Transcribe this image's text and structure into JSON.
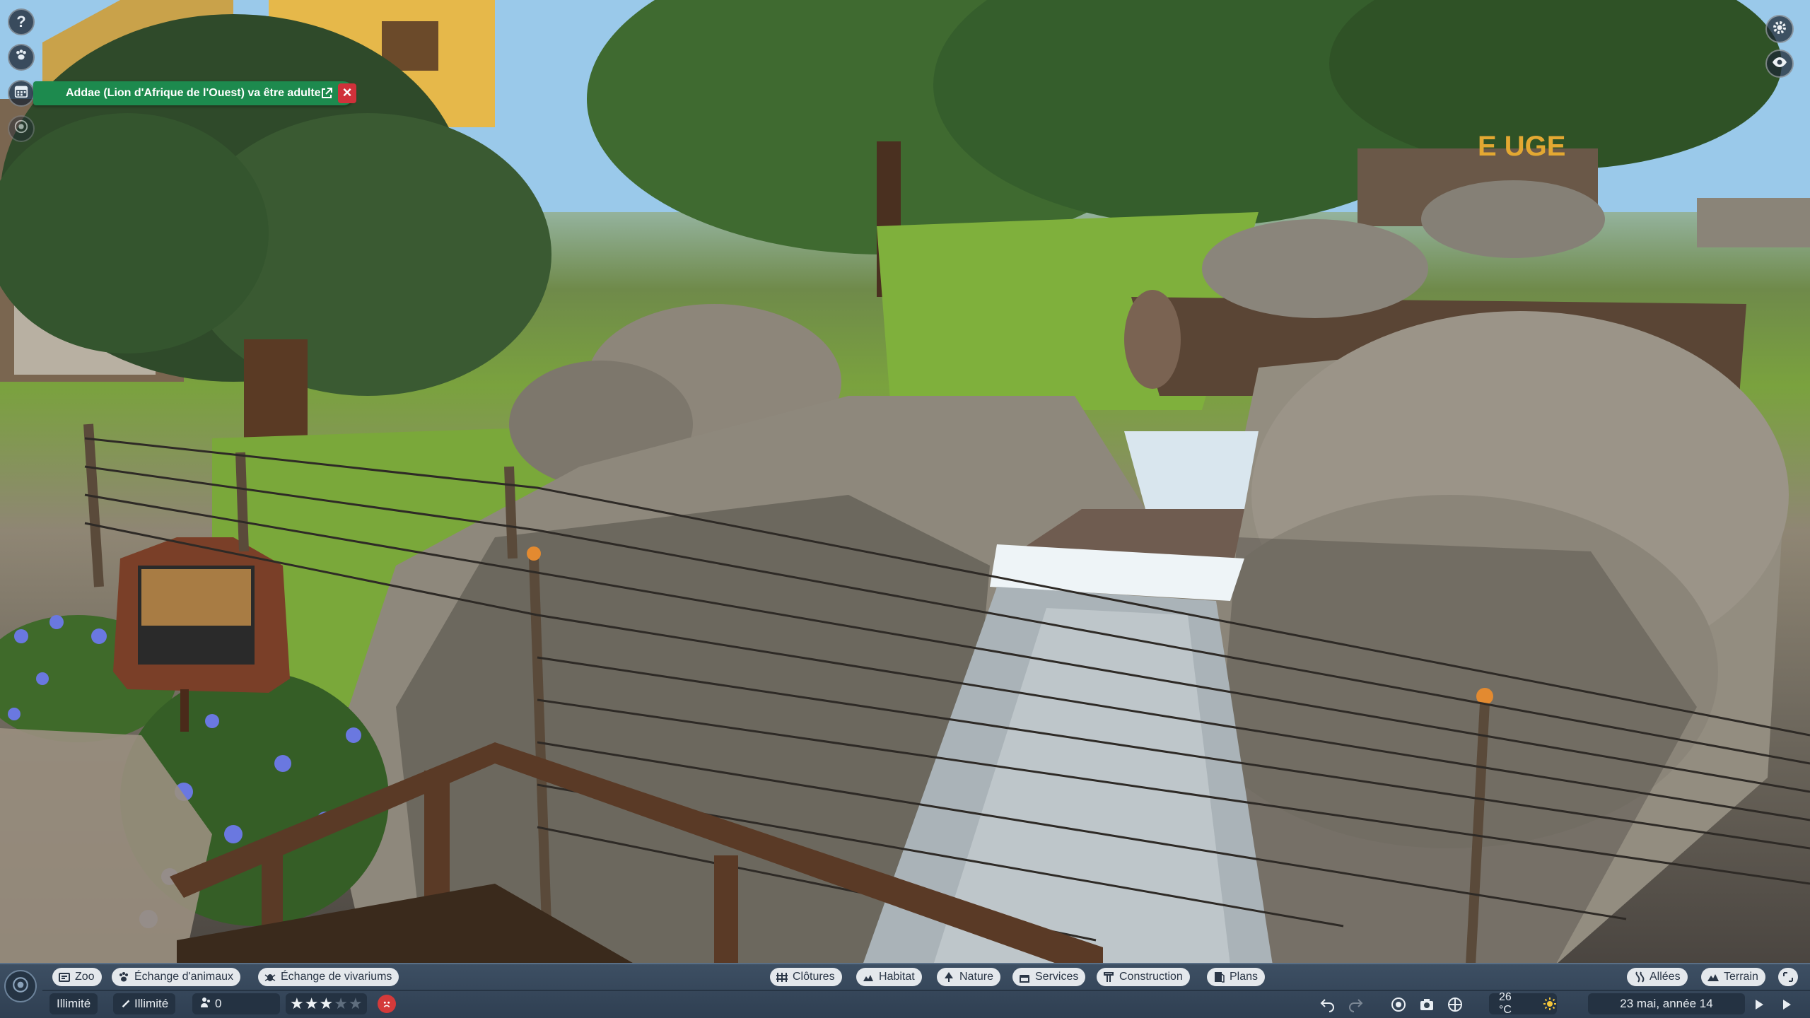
{
  "notification": {
    "text": "Addae (Lion d'Afrique de l'Ouest) va être adulte",
    "accent": "#1d8a4e",
    "close_color": "#d0313a"
  },
  "side_buttons": [
    {
      "name": "help-button",
      "icon": "help-icon",
      "glyph": "?"
    },
    {
      "name": "animal-button",
      "icon": "paw-icon"
    },
    {
      "name": "calendar-button",
      "icon": "calendar-icon"
    },
    {
      "name": "objectives-button",
      "icon": "target-icon"
    }
  ],
  "right_buttons": [
    {
      "name": "settings-button",
      "icon": "gear-icon"
    },
    {
      "name": "overlay-button",
      "icon": "eye-icon"
    }
  ],
  "toolbar": {
    "left_tabs": [
      {
        "label": "Zoo",
        "icon": "zoo-icon"
      },
      {
        "label": "Échange d'animaux",
        "icon": "paw-icon"
      },
      {
        "label": "Échange de vivariums",
        "icon": "bug-icon"
      }
    ],
    "center_tabs": [
      {
        "label": "Clôtures",
        "icon": "fence-icon"
      },
      {
        "label": "Habitat",
        "icon": "habitat-icon"
      },
      {
        "label": "Nature",
        "icon": "tree-icon"
      },
      {
        "label": "Services",
        "icon": "shop-icon"
      },
      {
        "label": "Construction",
        "icon": "build-icon"
      },
      {
        "label": "Plans",
        "icon": "blueprint-icon"
      }
    ],
    "right_tabs": [
      {
        "label": "Allées",
        "icon": "path-icon"
      },
      {
        "label": "Terrain",
        "icon": "terrain-icon"
      }
    ]
  },
  "status": {
    "money": "Illimité",
    "research": "Illimité",
    "guests": "0",
    "rating_stars": 3,
    "rating_max": 5,
    "temperature": "26 °C",
    "date": "23 mai, année 14"
  }
}
